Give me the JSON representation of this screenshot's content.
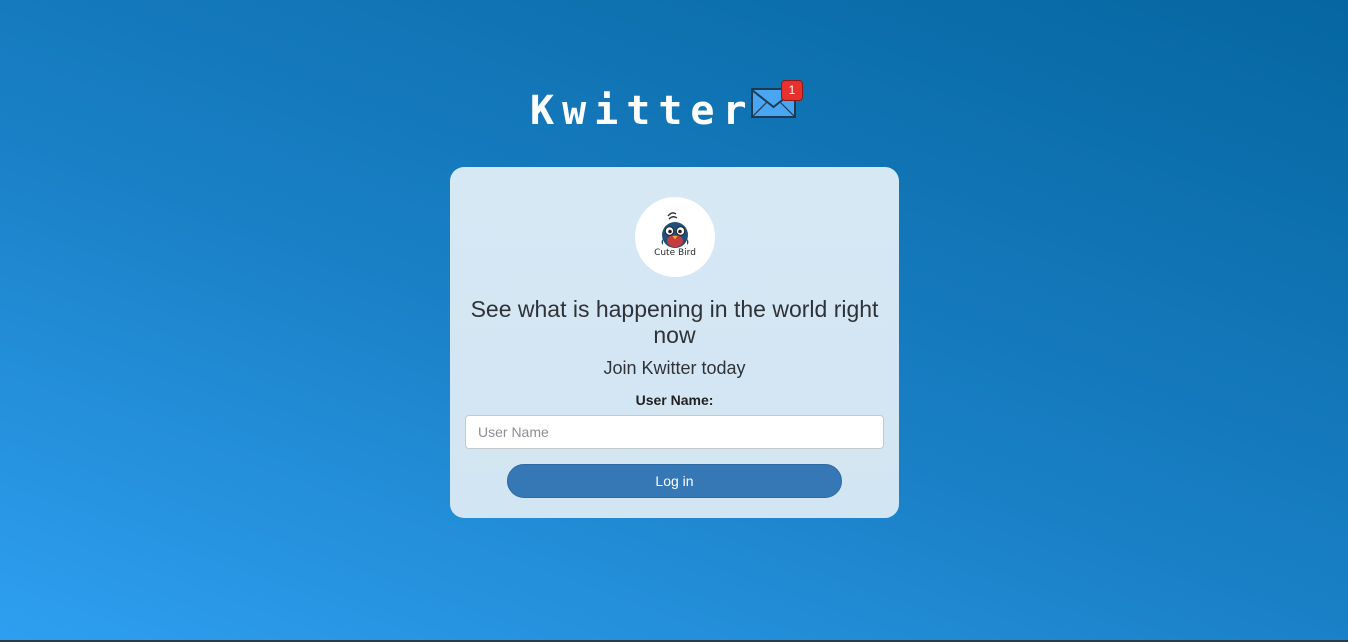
{
  "header": {
    "title": "Kwitter",
    "icon": "envelope-icon",
    "badge_count": "1"
  },
  "card": {
    "avatar_caption": "Cute Bird",
    "headline": "See what is happening in the world right now",
    "subheadline": "Join Kwitter today",
    "username_label": "User Name:",
    "username_placeholder": "User Name",
    "username_value": "",
    "login_label": "Log in"
  },
  "colors": {
    "background_start": "#2e9ff0",
    "background_end": "#0566a0",
    "card_background": "#d6e8f4",
    "button": "#3677b6",
    "badge": "#e8302e"
  }
}
